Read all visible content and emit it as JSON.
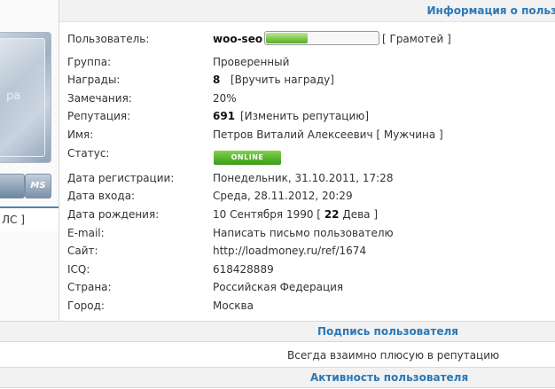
{
  "header": {
    "title": "Информация о польз"
  },
  "left": {
    "avatar_text": "pa",
    "ms_badge": "MS",
    "pm_link": "ЛС ]"
  },
  "profile": {
    "user_label": "Пользователь:",
    "username": "woo-seo",
    "diplomas_link": "[ Грамотей ]",
    "rep_progress": 0.38,
    "group_label": "Группа:",
    "group": "Проверенный",
    "awards_label": "Награды:",
    "awards_count": "8",
    "awards_link": "[Вручить награду]",
    "warnings_label": "Замечания:",
    "warnings": "20%",
    "reputation_label": "Репутация:",
    "reputation": "691",
    "reputation_link": "[Изменить репутацию]",
    "name_label": "Имя:",
    "name": "Петров Виталий Алексеевич [ Мужчина ]",
    "status_label": "Статус:",
    "status": "ONLINE",
    "reg_label": "Дата регистрации:",
    "reg_date": "Понедельник, 31.10.2011, 17:28",
    "login_label": "Дата входа:",
    "login_date": "Среда, 28.11.2012, 20:29",
    "birth_label": "Дата рождения:",
    "birth_date": "10 Сентября 1990 [ ",
    "birth_age": "22",
    "birth_sign": " Дева ]",
    "email_label": "E-mail:",
    "email_link": "Написать письмо пользователю",
    "site_label": "Сайт:",
    "site": "http://loadmoney.ru/ref/1674",
    "icq_label": "ICQ:",
    "icq": "618428889",
    "country_label": "Страна:",
    "country": "Российская Федерация",
    "city_label": "Город:",
    "city": "Москва"
  },
  "signature": {
    "title": "Подпись пользователя",
    "text": "Всегда взаимно плюсую в репутацию"
  },
  "activity": {
    "title": "Активность пользователя"
  }
}
